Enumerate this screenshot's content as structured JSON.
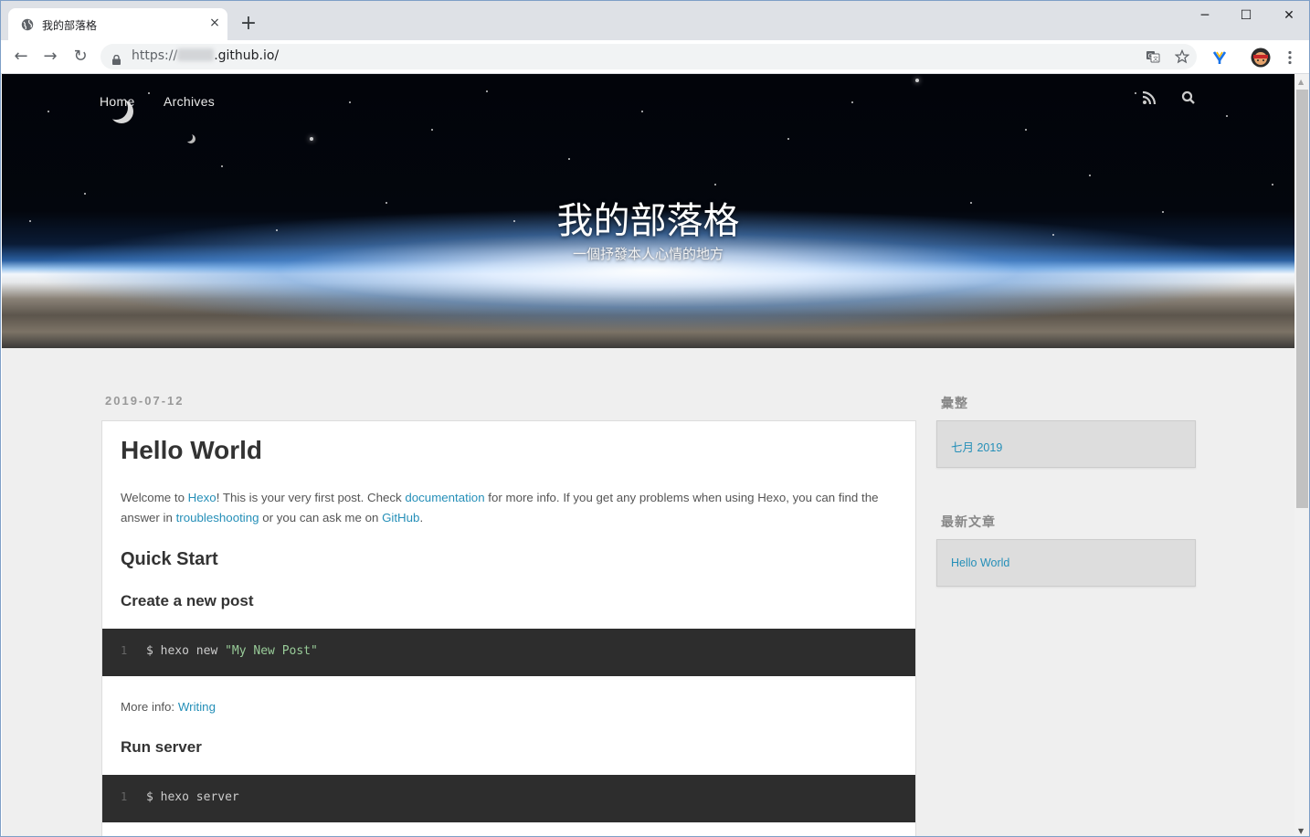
{
  "browser": {
    "tab_title": "我的部落格",
    "tab_close": "×",
    "new_tab": "+",
    "url_prefix": "https://",
    "url_suffix": ".github.io/",
    "window_controls": {
      "minimize": "─",
      "maximize": "☐",
      "close": "✕"
    },
    "nav": {
      "back": "←",
      "forward": "→",
      "reload": "↻"
    },
    "icons": [
      "globe-icon",
      "lock-icon",
      "translate-icon",
      "star-icon",
      "extension-icon",
      "profile-avatar",
      "menu-icon"
    ]
  },
  "site": {
    "nav": {
      "home": "Home",
      "archives": "Archives"
    },
    "title": "我的部落格",
    "subtitle": "一個抒發本人心情的地方"
  },
  "post": {
    "date": "2019-07-12",
    "title": "Hello World",
    "intro": {
      "t1": "Welcome to ",
      "link1": "Hexo",
      "t2": "! This is your very first post. Check ",
      "link2": "documentation",
      "t3": " for more info. If you get any problems when using Hexo, you can find the answer in ",
      "link3": "troubleshooting",
      "t4": " or you can ask me on ",
      "link4": "GitHub",
      "t5": "."
    },
    "quick_start": "Quick Start",
    "create_post": "Create a new post",
    "code1": {
      "ln": "1",
      "cmd": "$ hexo new ",
      "str": "\"My New Post\""
    },
    "more_info_label": "More info: ",
    "more_info_link": "Writing",
    "run_server": "Run server",
    "code2": {
      "ln": "1",
      "cmd": "$ hexo server"
    }
  },
  "sidebar": {
    "archives_title": "彙整",
    "archives_item": "七月 2019",
    "recent_title": "最新文章",
    "recent_item": "Hello World"
  },
  "colors": {
    "link": "#258fb8",
    "page_bg": "#efefef",
    "code_bg": "#2d2d2d",
    "code_string": "#99cc99"
  }
}
